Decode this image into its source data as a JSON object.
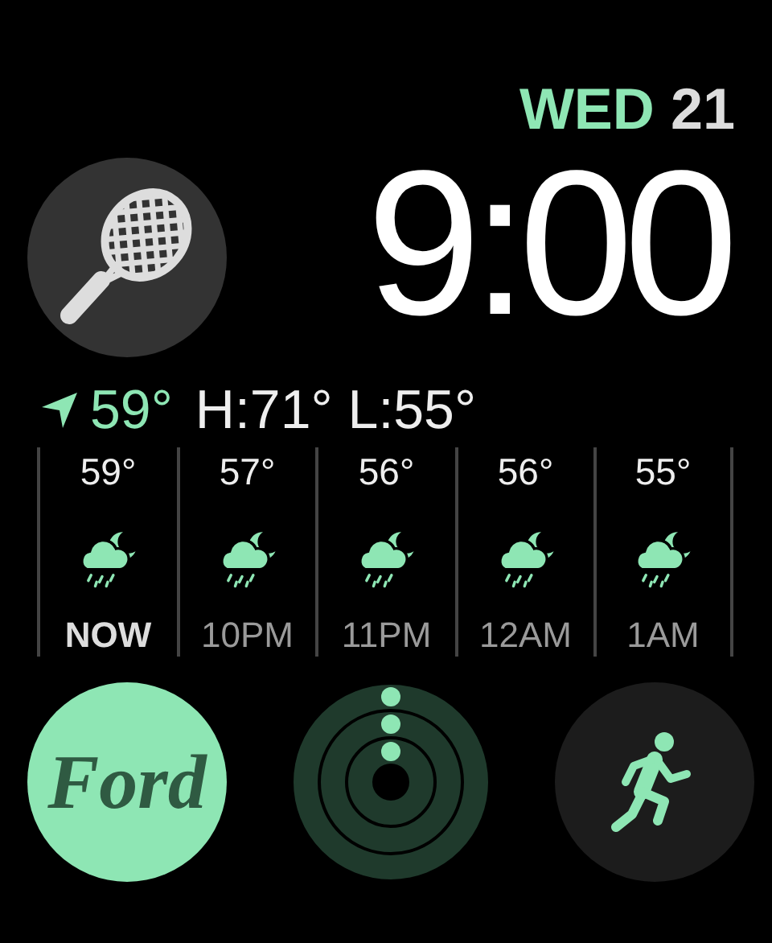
{
  "date": {
    "weekday": "WED",
    "day": "21"
  },
  "time": "9:00",
  "weather": {
    "current": "59°",
    "high_low": "H:71° L:55°",
    "hours": [
      {
        "temp": "59°",
        "label": "NOW",
        "current": true
      },
      {
        "temp": "57°",
        "label": "10PM",
        "current": false
      },
      {
        "temp": "56°",
        "label": "11PM",
        "current": false
      },
      {
        "temp": "56°",
        "label": "12AM",
        "current": false
      },
      {
        "temp": "55°",
        "label": "1AM",
        "current": false
      }
    ]
  },
  "ford_logo": "Ford"
}
